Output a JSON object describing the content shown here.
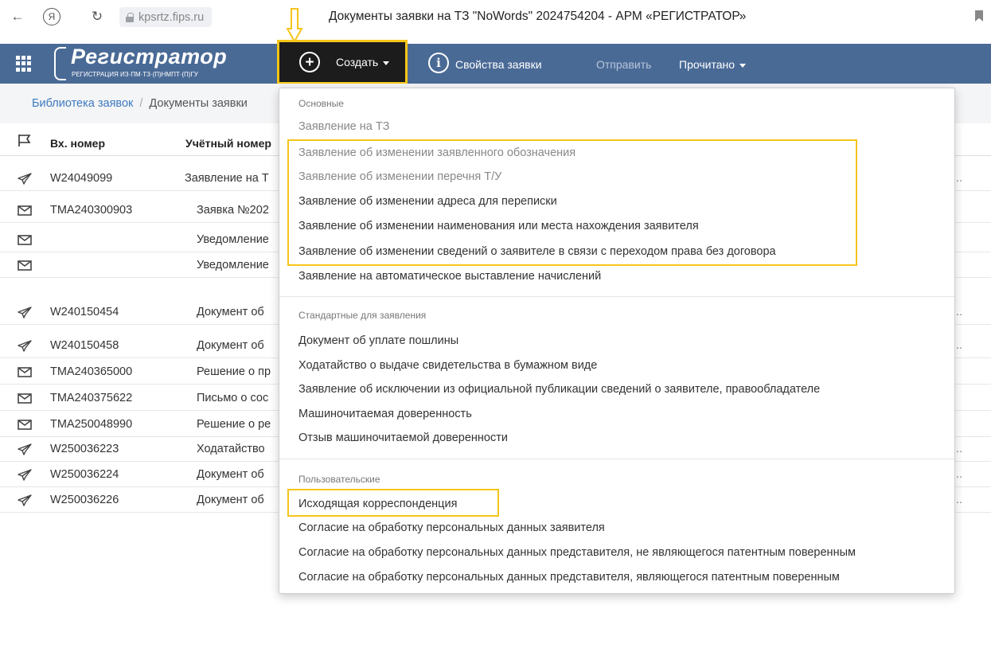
{
  "browser": {
    "back_icon": "←",
    "yandex_icon": "Я",
    "reload_icon": "↻",
    "url": "kpsrtz.fips.ru",
    "title": "Документы заявки на ТЗ \"NoWords\" 2024754204 - АРМ «РЕГИСТРАТОР»"
  },
  "header": {
    "logo_title": "Регистратор",
    "logo_subtitle": "РЕГИСТРАЦИЯ ИЗ·ПМ·ТЗ·(П)НМПТ·(П)ГУ",
    "create_label": "Создать",
    "properties_label": "Свойства заявки",
    "send_label": "Отправить",
    "read_label": "Прочитано",
    "bg_color": "#4a6a96",
    "highlight_color": "#f5c518"
  },
  "breadcrumb": {
    "library": "Библиотека заявок",
    "separator": "/",
    "current": "Документы заявки"
  },
  "table": {
    "col_number": "Вх. номер",
    "col_account": "Учётный номер",
    "rows": [
      {
        "icon": "send-icon",
        "number": "W24049099",
        "doc": "Заявление на Т",
        "ellipsis": ".."
      },
      {
        "icon": "envelope-icon",
        "number": "TMA240300903",
        "doc": "Заявка №202",
        "ellipsis": ""
      },
      {
        "icon": "envelope-icon",
        "number": "",
        "doc": "Уведомление",
        "ellipsis": ""
      },
      {
        "icon": "envelope-icon",
        "number": "",
        "doc": "Уведомление",
        "ellipsis": ""
      },
      {
        "icon": "send-icon",
        "number": "W240150454",
        "doc": "Документ об",
        "ellipsis": ".."
      },
      {
        "icon": "send-icon",
        "number": "W240150458",
        "doc": "Документ об",
        "ellipsis": ".."
      },
      {
        "icon": "envelope-icon",
        "number": "TMA240365000",
        "doc": "Решение о пр",
        "ellipsis": ""
      },
      {
        "icon": "envelope-icon",
        "number": "TMA240375622",
        "doc": "Письмо о сос",
        "ellipsis": ""
      },
      {
        "icon": "envelope-icon",
        "number": "TMA250048990",
        "doc": "Решение о ре",
        "ellipsis": ""
      },
      {
        "icon": "send-icon",
        "number": "W250036223",
        "doc": "Ходатайство",
        "ellipsis": ".."
      },
      {
        "icon": "send-icon",
        "number": "W250036224",
        "doc": "Документ об",
        "ellipsis": ".."
      },
      {
        "icon": "send-icon",
        "number": "W250036226",
        "doc": "Документ об",
        "ellipsis": ".."
      }
    ]
  },
  "dropdown": {
    "group_main": "Основные",
    "main_items": [
      "Заявление на ТЗ",
      "Заявление об изменении заявленного обозначения",
      "Заявление об изменении перечня Т/У",
      "Заявление об изменении адреса для переписки",
      "Заявление об изменении наименования или места нахождения заявителя",
      "Заявление об изменении сведений о заявителе в связи с переходом права без договора",
      "Заявление на автоматическое выставление начислений"
    ],
    "group_standard": "Стандартные для заявления",
    "standard_items": [
      "Документ об уплате пошлины",
      "Ходатайство о выдаче свидетельства в бумажном виде",
      "Заявление об исключении из официальной публикации сведений о заявителе, правообладателе",
      "Машиночитаемая доверенность",
      "Отзыв машиночитаемой доверенности"
    ],
    "group_user": "Пользовательские",
    "user_items": [
      "Исходящая корреспонденция",
      "Согласие на обработку персональных данных заявителя",
      "Согласие на обработку персональных данных представителя, не являющегося патентным поверенным",
      "Согласие на обработку персональных данных представителя, являющегося патентным поверенным"
    ]
  }
}
